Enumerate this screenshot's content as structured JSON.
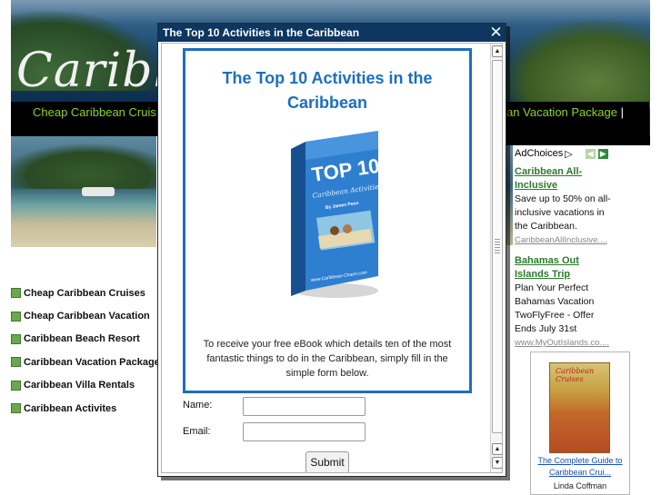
{
  "site": {
    "brand": "Caribb",
    "nav_left": "Cheap Caribbean Cruis",
    "nav_right": "an Vacation Package",
    "nav_right_sep": "|"
  },
  "side_nav": [
    {
      "label": "Cheap Caribbean Cruises"
    },
    {
      "label": "Cheap Caribbean Vacation"
    },
    {
      "label": "Caribbean Beach Resort"
    },
    {
      "label": "Caribbean Vacation Package"
    },
    {
      "label": "Caribbean Villa Rentals"
    },
    {
      "label": "Caribbean Activites"
    }
  ],
  "ads": {
    "adchoices": "AdChoices",
    "adchoices_icon": "▷",
    "prev_icon": "◀",
    "next_icon": "▶",
    "items": [
      {
        "title": "Caribbean All-Inclusive",
        "desc": "Save up to 50% on all-inclusive vacations in the Caribbean.",
        "url": "CaribbeanAllInclusive...."
      },
      {
        "title": "Bahamas Out Islands Trip",
        "desc": "Plan Your Perfect Bahamas Vacation TwoFlyFree - Offer Ends July 31st",
        "url": "www.MyOutIslands.co...."
      }
    ]
  },
  "book_ad": {
    "cover_text": "Caribbean Cruises",
    "link_line1": "The Complete Guide to",
    "link_line2": "Caribbean Crui...",
    "author": "Linda Coffman"
  },
  "popup": {
    "title": "The Top 10 Activities in the Caribbean",
    "close_icon": "✕",
    "heading": "The Top 10 Activities in the Caribbean",
    "ebook": {
      "top": "TOP 10",
      "subtitle": "Caribbean Activities",
      "author": "By James Penn",
      "site": "www.Caribbean-Charm.com"
    },
    "description": "To receive your free eBook which details ten of the most fantastic things to do in the Caribbean, simply fill in the simple form below.",
    "name_label": "Name:",
    "name_value": "",
    "email_label": "Email:",
    "email_value": "",
    "submit_label": "Submit",
    "scroll_up": "▲",
    "scroll_down": "▼"
  }
}
